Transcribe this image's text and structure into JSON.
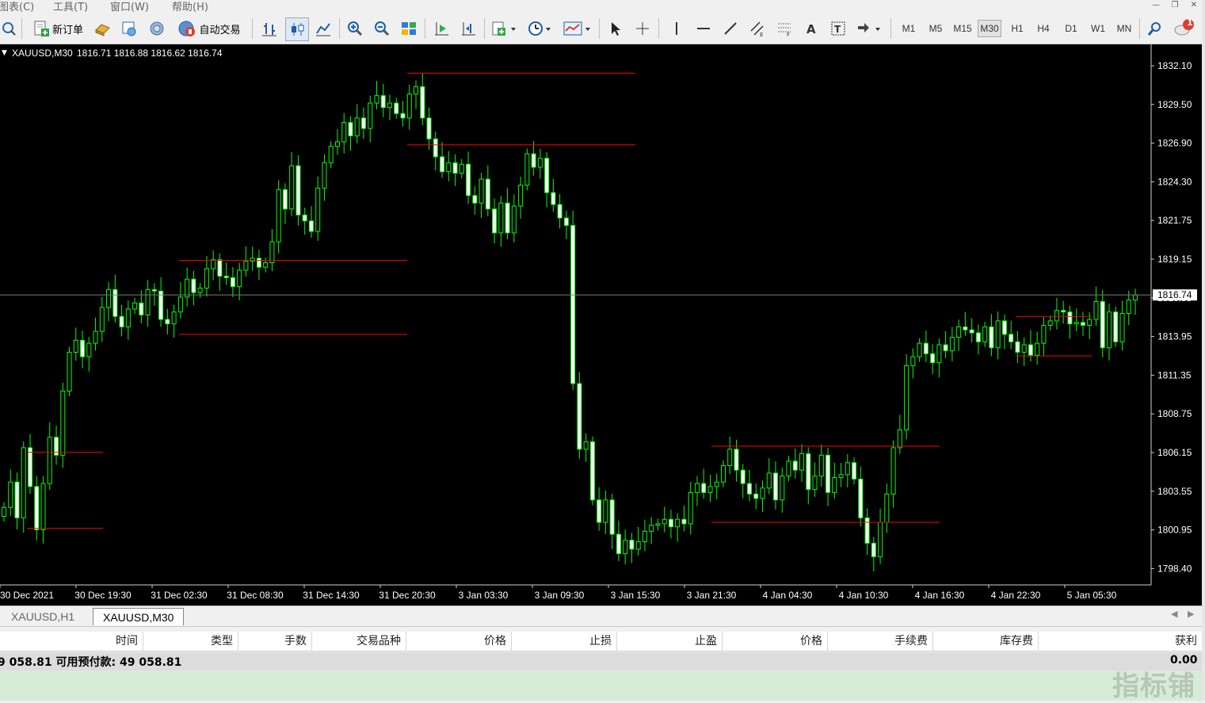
{
  "menu": {
    "items": [
      "图表(C)",
      "工具(T)",
      "窗口(W)",
      "帮助(H)"
    ]
  },
  "toolbar": {
    "new_order_label": "新订单",
    "autotrade_label": "自动交易",
    "timeframes": [
      "M1",
      "M5",
      "M15",
      "M30",
      "H1",
      "H4",
      "D1",
      "W1",
      "MN"
    ],
    "active_timeframe": "M30",
    "notification_count": "1"
  },
  "chart": {
    "title": "XAUUSD,M30",
    "ohlc": "1816.71 1816.88 1816.62 1816.74",
    "current_price": "1816.74",
    "price_labels": [
      "1832.10",
      "1829.50",
      "1826.90",
      "1824.30",
      "1821.75",
      "1819.15",
      "1816.55",
      "1813.95",
      "1811.35",
      "1808.75",
      "1806.15",
      "1803.55",
      "1800.95",
      "1798.40"
    ],
    "time_labels": [
      "30 Dec 2021",
      "30 Dec 19:30",
      "31 Dec 02:30",
      "31 Dec 08:30",
      "31 Dec 14:30",
      "31 Dec 20:30",
      "3 Jan 03:30",
      "3 Jan 09:30",
      "3 Jan 15:30",
      "3 Jan 21:30",
      "4 Jan 04:30",
      "4 Jan 10:30",
      "4 Jan 16:30",
      "4 Jan 22:30",
      "5 Jan 05:30"
    ],
    "colors": {
      "background": "#000000",
      "candle": "#00ff00",
      "bull_body": "#000000",
      "bear_body": "#ffffff",
      "level_line": "#ff0000",
      "bid_line": "#7a7a7a",
      "text": "#ffffff"
    },
    "level_lines": [
      {
        "from": "30 Dec 2021",
        "to": "30 Dec 19:30",
        "price": 1806.2
      },
      {
        "from": "30 Dec 2021",
        "to": "30 Dec 19:30",
        "price": 1801.1
      },
      {
        "from": "31 Dec 02:30",
        "to": "31 Dec 20:30",
        "price": 1819.05
      },
      {
        "from": "31 Dec 02:30",
        "to": "31 Dec 20:30",
        "price": 1814.1
      },
      {
        "from": "31 Dec 20:30",
        "to": "3 Jan 15:30",
        "price": 1831.6
      },
      {
        "from": "31 Dec 20:30",
        "to": "3 Jan 15:30",
        "price": 1826.8
      },
      {
        "from": "3 Jan 21:30",
        "to": "4 Jan 16:30",
        "price": 1806.6
      },
      {
        "from": "3 Jan 21:30",
        "to": "4 Jan 16:30",
        "price": 1801.5
      },
      {
        "from": "4 Jan 22:30",
        "to": "5 Jan 05:30",
        "price": 1815.3
      },
      {
        "from": "4 Jan 22:30",
        "to": "5 Jan 05:30",
        "price": 1812.65
      }
    ],
    "closes": [
      1802.5,
      1804.2,
      1801.8,
      1806.5,
      1803.9,
      1801.0,
      1804.1,
      1807.2,
      1806.0,
      1810.3,
      1812.9,
      1813.7,
      1812.6,
      1813.5,
      1814.3,
      1815.9,
      1817.1,
      1815.3,
      1814.6,
      1815.8,
      1816.2,
      1815.4,
      1817.1,
      1817.0,
      1815.1,
      1814.8,
      1815.6,
      1816.6,
      1817.8,
      1816.9,
      1817.2,
      1818.5,
      1819.1,
      1818.0,
      1817.9,
      1817.3,
      1818.4,
      1819.0,
      1819.2,
      1818.6,
      1818.9,
      1820.3,
      1823.8,
      1822.5,
      1825.4,
      1822.1,
      1821.7,
      1821.0,
      1823.9,
      1825.6,
      1826.7,
      1827.0,
      1828.3,
      1827.4,
      1828.6,
      1827.9,
      1829.6,
      1830.1,
      1829.3,
      1829.6,
      1828.9,
      1828.6,
      1830.2,
      1830.7,
      1828.6,
      1827.2,
      1826.0,
      1825.0,
      1825.6,
      1824.9,
      1825.5,
      1823.4,
      1822.9,
      1824.5,
      1822.5,
      1820.9,
      1822.9,
      1820.9,
      1822.7,
      1824.1,
      1826.2,
      1825.3,
      1825.9,
      1823.6,
      1822.8,
      1821.9,
      1821.4,
      1810.8,
      1806.4,
      1806.9,
      1803.0,
      1801.5,
      1803.0,
      1800.7,
      1799.4,
      1800.3,
      1799.7,
      1800.2,
      1800.9,
      1801.3,
      1801.4,
      1801.7,
      1801.2,
      1801.7,
      1801.4,
      1803.5,
      1804.1,
      1803.5,
      1803.9,
      1804.2,
      1805.3,
      1806.4,
      1805.0,
      1804.1,
      1803.4,
      1803.1,
      1803.8,
      1804.8,
      1803.0,
      1804.6,
      1805.6,
      1805.0,
      1806.1,
      1803.7,
      1804.6,
      1806.0,
      1803.5,
      1804.5,
      1804.7,
      1805.5,
      1804.4,
      1801.8,
      1800.1,
      1799.2,
      1801.5,
      1803.4,
      1806.5,
      1807.7,
      1812.0,
      1812.6,
      1813.5,
      1812.8,
      1812.2,
      1813.4,
      1813.0,
      1813.9,
      1814.6,
      1814.4,
      1814.2,
      1813.6,
      1814.6,
      1813.2,
      1815.0,
      1814.1,
      1813.6,
      1812.9,
      1813.4,
      1812.7,
      1813.5,
      1814.7,
      1815.0,
      1815.7,
      1815.6,
      1814.8,
      1814.9,
      1814.7,
      1815.1,
      1816.3,
      1813.2,
      1815.6,
      1813.6,
      1815.5,
      1816.4,
      1816.74
    ]
  },
  "tabs": {
    "items": [
      "XAUUSD,H1",
      "XAUUSD,M30"
    ],
    "active": "XAUUSD,M30"
  },
  "terminal": {
    "columns": [
      "时间",
      "类型",
      "手数",
      "交易品种",
      "价格",
      "止损",
      "止盈",
      "价格",
      "手续费",
      "库存费",
      "获利"
    ],
    "balance_text": "9 058.81  可用预付款: 49 058.81",
    "profit_total": "0.00"
  },
  "watermark": "指标铺"
}
